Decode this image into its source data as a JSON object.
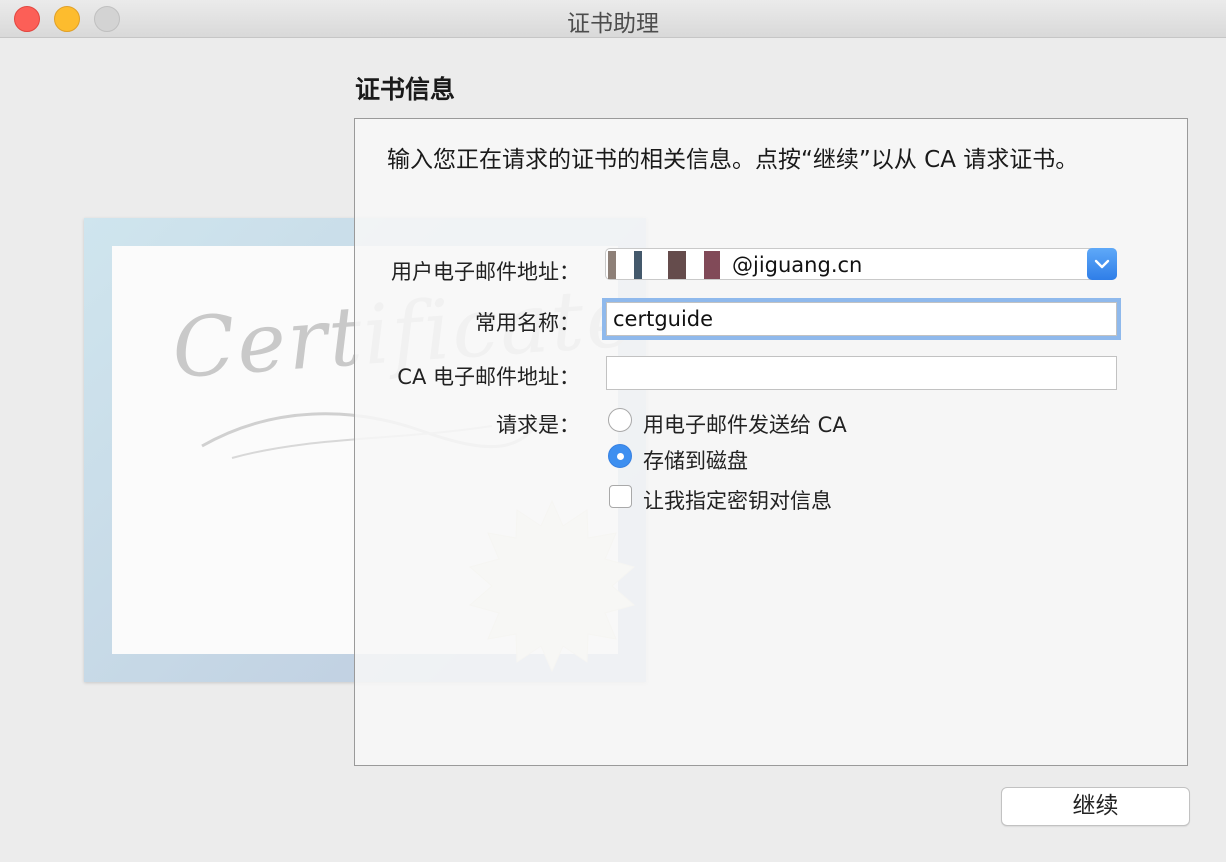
{
  "window": {
    "title": "证书助理"
  },
  "section_title": "证书信息",
  "intro_text": "输入您正在请求的证书的相关信息。点按“继续”以从 CA 请求证书。",
  "illustration": {
    "word": "Certificate"
  },
  "form": {
    "email_label": "用户电子邮件地址：",
    "email_value": "@jiguang.cn",
    "common_name_label": "常用名称：",
    "common_name_value": "certguide",
    "ca_email_label": "CA 电子邮件地址：",
    "ca_email_value": "",
    "request_label": "请求是：",
    "options": {
      "email_ca": "用电子邮件发送给 CA",
      "save_disk": "存储到磁盘",
      "specify_key": "让我指定密钥对信息"
    },
    "selected_option": "存储到磁盘"
  },
  "buttons": {
    "continue": "继续"
  },
  "colors": {
    "accent": "#3d8ff0",
    "focus_ring": "#8fb9ec"
  }
}
